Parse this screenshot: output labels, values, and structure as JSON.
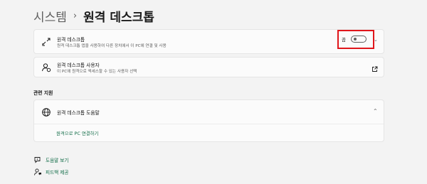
{
  "breadcrumb": {
    "parent": "시스템",
    "separator": "›",
    "current": "원격 데스크톱"
  },
  "remote_desktop": {
    "title": "원격 데스크톱",
    "subtitle": "원격 데스크톱 앱을 사용하여 다른 장치에서 이 PC에 연결 및 사용",
    "toggle_label": "끔",
    "toggle_state": "off",
    "highlight_color": "#e0161b"
  },
  "remote_users": {
    "title": "원격 데스크톱 사용자",
    "subtitle": "이 PC에 원격으로 액세스할 수 있는 사용자 선택"
  },
  "related_support": {
    "header": "관련 지원",
    "help_title": "원격 데스크톱 도움말",
    "link": "원격으로 PC 연결하기",
    "expanded": true
  },
  "bottom_links": {
    "get_help": "도움말 보기",
    "feedback": "피드백 제공"
  },
  "colors": {
    "background": "#f3f3f3",
    "card": "#fbfbfb",
    "accent_link": "#0f6b46"
  },
  "icons": {
    "remote_desktop": "remote-desktop-icon",
    "users": "remote-users-icon",
    "globe": "globe-icon",
    "external": "open-external-icon",
    "help": "get-help-icon",
    "feedback": "feedback-icon"
  }
}
